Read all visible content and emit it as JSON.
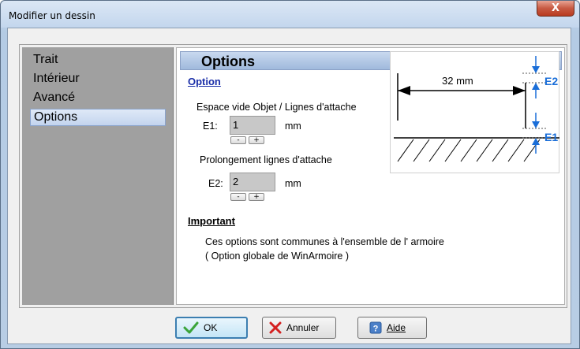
{
  "window": {
    "title": "Modifier un dessin",
    "close_label": "X"
  },
  "nav": {
    "items": [
      {
        "label": "Trait",
        "selected": false
      },
      {
        "label": "Intérieur",
        "selected": false
      },
      {
        "label": "Avancé",
        "selected": false
      },
      {
        "label": "Options",
        "selected": true
      }
    ]
  },
  "panel": {
    "title": "Options",
    "option_heading": "Option",
    "e1": {
      "caption": "Espace vide Objet / Lignes d'attache",
      "label": "E1:",
      "value": "1",
      "unit": "mm"
    },
    "e2": {
      "caption": "Prolongement lignes d'attache",
      "label": "E2:",
      "value": "2",
      "unit": "mm"
    },
    "spin_minus": "-",
    "spin_plus": "+",
    "important_heading": "Important",
    "note_line1": "Ces options sont communes à l'ensemble de l' armoire",
    "note_line2": "( Option globale de WinArmoire )"
  },
  "diagram": {
    "dimension": "32 mm",
    "e2": "E2",
    "e1": "E1"
  },
  "buttons": {
    "ok": "OK",
    "cancel": "Annuler",
    "help": "Aide"
  },
  "colors": {
    "accent_blue": "#1a2ea8",
    "diagram_blue": "#1a6ed8"
  }
}
